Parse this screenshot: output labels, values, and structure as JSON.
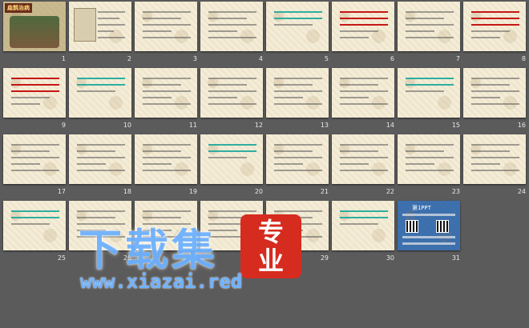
{
  "slides": [
    {
      "number": "1"
    },
    {
      "number": "2"
    },
    {
      "number": "3"
    },
    {
      "number": "4"
    },
    {
      "number": "5"
    },
    {
      "number": "6"
    },
    {
      "number": "7"
    },
    {
      "number": "8"
    },
    {
      "number": "9"
    },
    {
      "number": "10"
    },
    {
      "number": "11"
    },
    {
      "number": "12"
    },
    {
      "number": "13"
    },
    {
      "number": "14"
    },
    {
      "number": "15"
    },
    {
      "number": "16"
    },
    {
      "number": "17"
    },
    {
      "number": "18"
    },
    {
      "number": "19"
    },
    {
      "number": "20"
    },
    {
      "number": "21"
    },
    {
      "number": "22"
    },
    {
      "number": "23"
    },
    {
      "number": "24"
    },
    {
      "number": "25"
    },
    {
      "number": "26"
    },
    {
      "number": "27"
    },
    {
      "number": "28"
    },
    {
      "number": "29"
    },
    {
      "number": "30"
    },
    {
      "number": "31"
    }
  ],
  "slide1": {
    "title_tag": "扁鹊治病"
  },
  "slide31": {
    "title": "第1PPT"
  },
  "watermark": {
    "main_text": "下载集",
    "badge_top": "专",
    "badge_bottom": "业",
    "url": "www.xiazai.red"
  },
  "colors": {
    "background": "#5b5b5b",
    "slide_paper": "#f4ecd6",
    "accent_red": "#c00000",
    "accent_teal": "#1aa79b",
    "watermark_blue": "#6fb2ff",
    "badge_red": "#d62b1f"
  }
}
